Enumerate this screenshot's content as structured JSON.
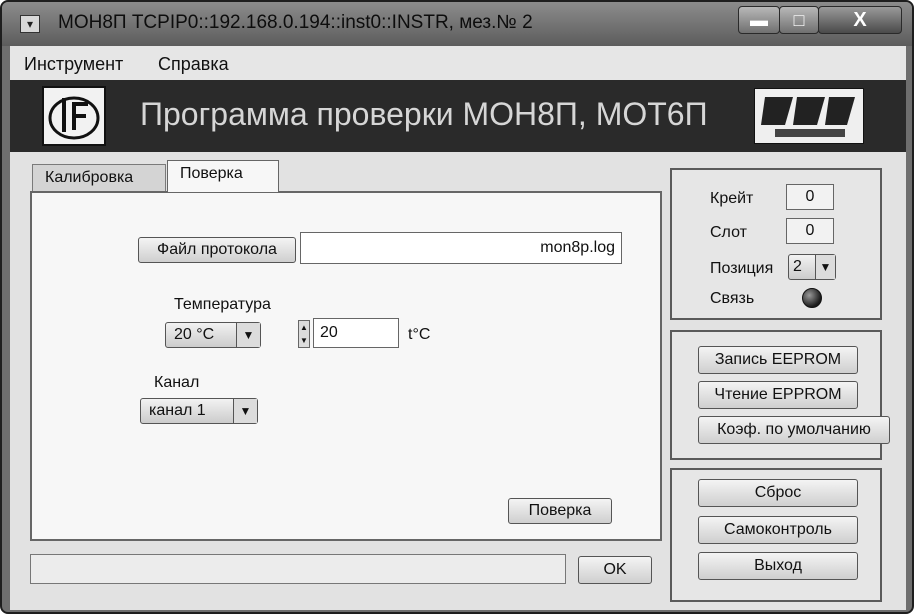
{
  "window": {
    "title": "МОН8П TCPIP0::192.168.0.194::inst0::INSTR, мез.№ 2",
    "controls": {
      "minimize": "▬",
      "maximize": "□",
      "close": "X"
    }
  },
  "menu": {
    "items": [
      "Инструмент",
      "Справка"
    ]
  },
  "banner": {
    "title": "Программа проверки МОН8П, МОТ6П"
  },
  "tabs": [
    {
      "label": "Калибровка",
      "active": false
    },
    {
      "label": "Поверка",
      "active": true
    }
  ],
  "verification": {
    "protocol_file_button": "Файл протокола",
    "protocol_file_value": "mon8p.log",
    "temperature_label": "Температура",
    "temperature_select": "20 °C",
    "temperature_value": "20",
    "temperature_unit": "t°C",
    "channel_label": "Канал",
    "channel_select": "канал 1",
    "verify_button": "Поверка"
  },
  "footer": {
    "ok_button": "OK",
    "status_text": ""
  },
  "info_panel": {
    "crate_label": "Крейт",
    "crate_value": "0",
    "slot_label": "Слот",
    "slot_value": "0",
    "position_label": "Позиция",
    "position_value": "2",
    "link_label": "Связь"
  },
  "eeprom_panel": {
    "write_button": "Запись EEPROM",
    "read_button": "Чтение EPPROM",
    "default_coef_button": "Коэф. по умолчанию"
  },
  "control_panel": {
    "reset_button": "Сброс",
    "selftest_button": "Самоконтроль",
    "exit_button": "Выход"
  }
}
